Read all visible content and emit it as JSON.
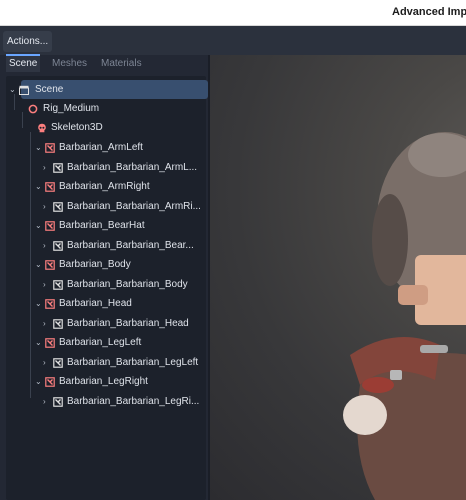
{
  "window": {
    "title": "Advanced Impo"
  },
  "toolbar": {
    "actions_label": "Actions..."
  },
  "tabs": [
    {
      "label": "Scene",
      "active": true
    },
    {
      "label": "Meshes",
      "active": false
    },
    {
      "label": "Materials",
      "active": false
    }
  ],
  "tree": [
    {
      "label": "Scene",
      "icon": "clapperboard-icon",
      "color": "#e0e0e0"
    },
    {
      "label": "Rig_Medium",
      "icon": "node3d-circle-icon",
      "color": "#fc7f7f"
    },
    {
      "label": "Skeleton3D",
      "icon": "skeleton-icon",
      "color": "#fc7f7f"
    },
    {
      "label": "Barbarian_ArmLeft",
      "icon": "mesh-instance-icon",
      "color": "#fc7f7f"
    },
    {
      "label": "Barbarian_Barbarian_ArmL...",
      "icon": "mesh-icon",
      "color": "#e0e0e0"
    },
    {
      "label": "Barbarian_ArmRight",
      "icon": "mesh-instance-icon",
      "color": "#fc7f7f"
    },
    {
      "label": "Barbarian_Barbarian_ArmRi...",
      "icon": "mesh-icon",
      "color": "#e0e0e0"
    },
    {
      "label": "Barbarian_BearHat",
      "icon": "mesh-instance-icon",
      "color": "#fc7f7f"
    },
    {
      "label": "Barbarian_Barbarian_Bear...",
      "icon": "mesh-icon",
      "color": "#e0e0e0"
    },
    {
      "label": "Barbarian_Body",
      "icon": "mesh-instance-icon",
      "color": "#fc7f7f"
    },
    {
      "label": "Barbarian_Barbarian_Body",
      "icon": "mesh-icon",
      "color": "#e0e0e0"
    },
    {
      "label": "Barbarian_Head",
      "icon": "mesh-instance-icon",
      "color": "#fc7f7f"
    },
    {
      "label": "Barbarian_Barbarian_Head",
      "icon": "mesh-icon",
      "color": "#e0e0e0"
    },
    {
      "label": "Barbarian_LegLeft",
      "icon": "mesh-instance-icon",
      "color": "#fc7f7f"
    },
    {
      "label": "Barbarian_Barbarian_LegLeft",
      "icon": "mesh-icon",
      "color": "#e0e0e0"
    },
    {
      "label": "Barbarian_LegRight",
      "icon": "mesh-instance-icon",
      "color": "#fc7f7f"
    },
    {
      "label": "Barbarian_Barbarian_LegRi...",
      "icon": "mesh-icon",
      "color": "#e0e0e0"
    }
  ],
  "viewport": {
    "content": "3d-character-preview"
  }
}
